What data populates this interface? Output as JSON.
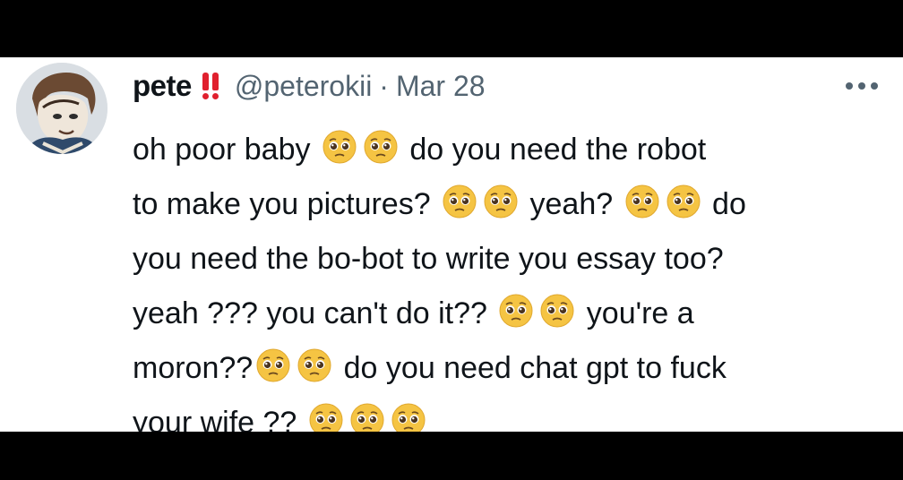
{
  "tweet": {
    "author_name": "pete",
    "author_handle": "@peterokii",
    "separator": "·",
    "date": "Mar 28",
    "more_icon": "more-horizontal-icon",
    "emoji_name": "pleading-face",
    "body_lines": [
      [
        "oh poor baby ",
        "EMOJI",
        "EMOJI",
        " do you need the robot"
      ],
      [
        "to make you pictures? ",
        "EMOJI",
        "EMOJI",
        " yeah? ",
        "EMOJI",
        "EMOJI",
        " do"
      ],
      [
        "you need the bo-bot to write you essay too?"
      ],
      [
        "yeah ??? you can't do it?? ",
        "EMOJI",
        "EMOJI",
        " you're a"
      ],
      [
        "moron??",
        "EMOJI",
        "EMOJI",
        " do you need chat gpt to fuck"
      ],
      [
        "your wife ?? ",
        "EMOJI",
        "EMOJI",
        "EMOJI"
      ]
    ],
    "colors": {
      "text": "#0f1419",
      "secondary": "#536471",
      "bang": "#e0202e",
      "emoji_face": "#f5c443"
    }
  }
}
